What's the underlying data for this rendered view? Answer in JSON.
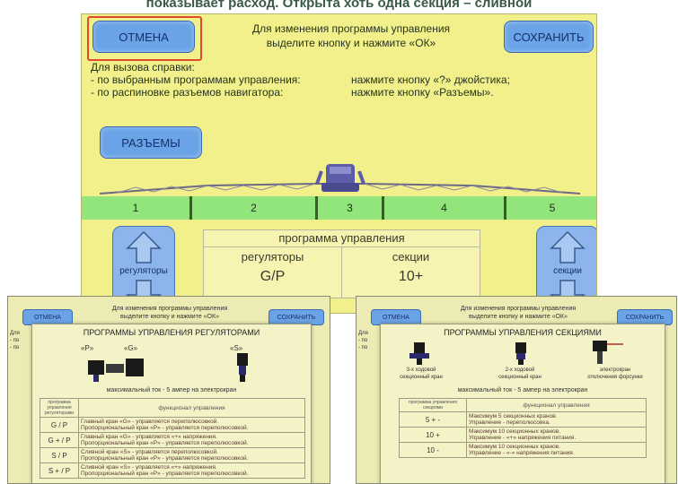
{
  "caption": "показывает расход. Открыта хоть одна секция – сливной",
  "main": {
    "cancel_label": "ОТМЕНА",
    "save_label": "СОХРАНИТЬ",
    "instruction_line1": "Для изменения программы управления",
    "instruction_line2": "выделите кнопку и нажмите «ОК»",
    "help_title": "Для вызова справки:",
    "help_row1_left": "- по выбранным программам управления:",
    "help_row1_right": "нажмите кнопку «?» джойстика;",
    "help_row2_left": "- по распиновке разъемов навигатора:",
    "help_row2_right": "нажмите кнопку «Разъемы».",
    "connectors_label": "РАЗЪЕМЫ",
    "sections": [
      "1",
      "2",
      "3",
      "4",
      "5"
    ],
    "regulators_button": "регуляторы",
    "sections_button": "секции",
    "program": {
      "title": "программа управления",
      "regulators_header": "регуляторы",
      "regulators_value": "G/P",
      "sections_header": "секции",
      "sections_value": "10+"
    }
  },
  "left_sub": {
    "cancel_label": "ОТМЕНА",
    "save_label": "СОХРАНИТЬ",
    "instruction_line1": "Для изменения программы управления",
    "instruction_line2": "выделите кнопку и нажмите «ОК»",
    "side_frag1": "Для",
    "side_frag2": "- по",
    "side_frag3": "- по",
    "popup": {
      "title": "ПРОГРАММЫ УПРАВЛЕНИЯ РЕГУЛЯТОРАМИ",
      "label_p": "«P»",
      "label_g": "«G»",
      "label_s": "«S»",
      "max_current": "максимальный ток - 5 ампер на электрокран",
      "col1": "программа управления регуляторами",
      "col2": "функционал управления",
      "rows": [
        {
          "code": "G / P",
          "line1": "Главный кран «G» - управляется переполюсовкой.",
          "line2": "Пропорциональный кран «P» - управляется переполюсовкой."
        },
        {
          "code": "G + / P",
          "line1": "Главный кран «G» - управляется «+» напряжения.",
          "line2": "Пропорциональный кран «P» - управляется переполюсовкой."
        },
        {
          "code": "S / P",
          "line1": "Сливной кран «S» - управляется переполюсовкой.",
          "line2": "Пропорциональный кран «P» - управляется переполюсовкой."
        },
        {
          "code": "S + / P",
          "line1": "Сливной кран «S» - управляется «+» напряжения.",
          "line2": "Пропорциональный кран «P» - управляется переполюсовкой."
        }
      ]
    }
  },
  "right_sub": {
    "cancel_label": "ОТМЕНА",
    "save_label": "СОХРАНИТЬ",
    "instruction_line1": "Для изменения программы управления",
    "instruction_line2": "выделите кнопку и нажмите «ОК»",
    "side_frag1": "Для",
    "side_frag2": "- по",
    "side_frag3": "- по",
    "popup": {
      "title": "ПРОГРАММЫ УПРАВЛЕНИЯ СЕКЦИЯМИ",
      "valve3_line1": "3-х ходовой",
      "valve3_line2": "секционный кран",
      "valve2_line1": "2-х ходовой",
      "valve2_line2": "секционный кран",
      "valve_e_line1": "электрокран",
      "valve_e_line2": "отключения форсунки",
      "max_current": "максимальный ток - 5 ампер на электрокран",
      "col1": "программа управления секциями",
      "col2": "функционал управления",
      "rows": [
        {
          "code": "5 + -",
          "line1": "Максимум 5 секционных кранов.",
          "line2": "Управление - переполюсовка."
        },
        {
          "code": "10 +",
          "line1": "Максимум 10 секционных кранов.",
          "line2": "Управление - «+» напряжения питания."
        },
        {
          "code": "10 -",
          "line1": "Максимум 10 секционных кранов.",
          "line2": "Управление - «-» напряжения питания."
        }
      ]
    }
  },
  "colors": {
    "screen_bg": "#f2f08a",
    "button_blue": "#6aa3e6",
    "highlight_red": "#e0492a",
    "section_green": "#92e57a",
    "boom_purple": "#5c5ca8"
  }
}
